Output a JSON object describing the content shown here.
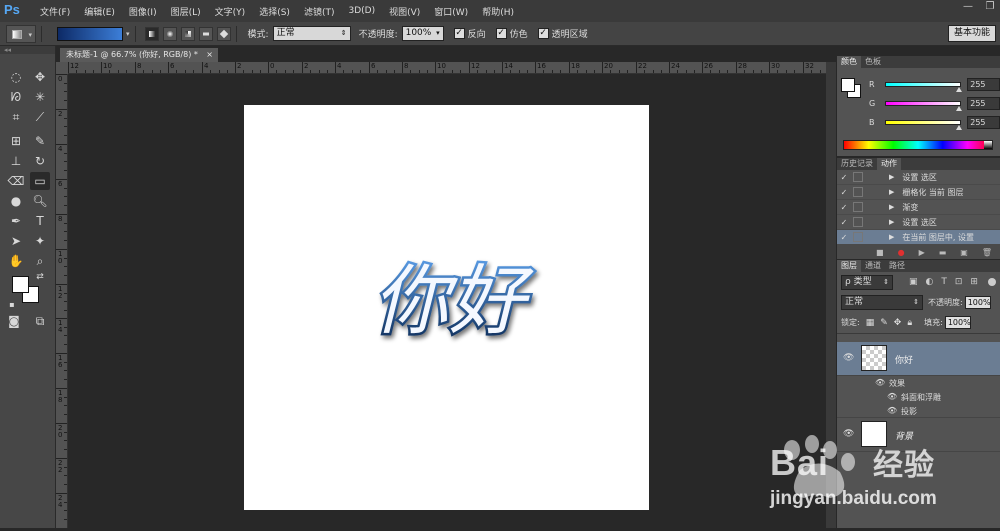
{
  "app": {
    "logo": "Ps"
  },
  "menu": [
    "文件(F)",
    "编辑(E)",
    "图像(I)",
    "图层(L)",
    "文字(Y)",
    "选择(S)",
    "滤镜(T)",
    "3D(D)",
    "视图(V)",
    "窗口(W)",
    "帮助(H)"
  ],
  "window_controls": [
    "—",
    "❐"
  ],
  "options": {
    "mode_label": "模式:",
    "mode_value": "正常",
    "opacity_label": "不透明度:",
    "opacity_value": "100%",
    "reverse_label": "反向",
    "dither_label": "仿色",
    "transparency_label": "透明区域",
    "workspace_label": "基本功能"
  },
  "document": {
    "tab_title": "未标题-1 @ 66.7% (你好, RGB/8) *",
    "tab_close": "×",
    "canvas_text": "你好"
  },
  "ruler": {
    "h": [
      "12",
      "10",
      "8",
      "6",
      "4",
      "2",
      "0",
      "2",
      "4",
      "6",
      "8",
      "10",
      "12",
      "14",
      "16",
      "18",
      "20",
      "22",
      "24",
      "26",
      "28",
      "30",
      "32"
    ],
    "v": [
      "0",
      "2",
      "4",
      "6",
      "8",
      "10",
      "12",
      "14",
      "16",
      "18",
      "20",
      "22",
      "24"
    ]
  },
  "color_panel": {
    "tabs": [
      "颜色",
      "色板"
    ],
    "channels": [
      {
        "label": "R",
        "value": "255",
        "gradient": "#00ffff"
      },
      {
        "label": "G",
        "value": "255",
        "gradient": "#ff00ff"
      },
      {
        "label": "B",
        "value": "255",
        "gradient": "#ffff00"
      }
    ]
  },
  "history_panel": {
    "tabs": [
      "历史记录",
      "动作"
    ],
    "items": [
      {
        "label": "设置 选区",
        "selected": false
      },
      {
        "label": "栅格化 当前 图层",
        "selected": false
      },
      {
        "label": "渐变",
        "selected": false
      },
      {
        "label": "设置 选区",
        "selected": false
      },
      {
        "label": "在当前 图层中, 设置",
        "selected": true
      }
    ]
  },
  "layers_panel": {
    "tabs": [
      "图层",
      "通道",
      "路径"
    ],
    "filter_kind": "ρ 类型",
    "blend_mode": "正常",
    "opacity_label": "不透明度:",
    "opacity_value": "100%",
    "lock_label": "锁定:",
    "fill_label": "填充:",
    "fill_value": "100%",
    "layers": [
      {
        "name": "你好",
        "selected": true
      },
      {
        "name": "背景",
        "selected": false
      }
    ],
    "effects_label": "效果",
    "effects": [
      "斜面和浮雕",
      "投影"
    ]
  },
  "watermark": {
    "brand": "Bai",
    "brand2": "经验",
    "url": "jingyan.baidu.com"
  }
}
